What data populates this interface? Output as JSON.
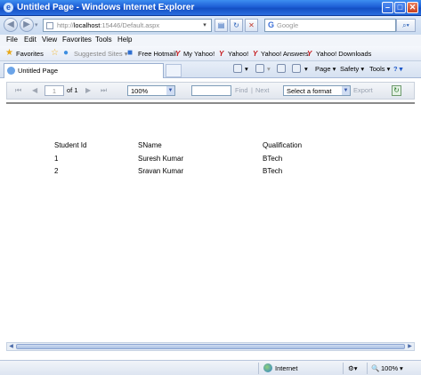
{
  "window": {
    "title": "Untitled Page - Windows Internet Explorer",
    "min": "–",
    "max": "□",
    "close": "✕"
  },
  "address": {
    "back": "◀",
    "forward": "▶",
    "url_prefix": "http://",
    "url_host": "localhost",
    "url_rest": ":15446/Default.aspx",
    "search_placeholder": "Google",
    "search_logo": "G"
  },
  "menu": [
    "File",
    "Edit",
    "View",
    "Favorites",
    "Tools",
    "Help"
  ],
  "favorites_bar": {
    "favorites_label": "Favorites",
    "suggested": "Suggested Sites ▾",
    "items": [
      "Free Hotmail",
      "My Yahoo!",
      "Yahoo!",
      "Yahoo! Answers",
      "Yahoo! Downloads"
    ]
  },
  "tab": {
    "label": "Untitled Page"
  },
  "command_bar": {
    "page": "Page ▾",
    "safety": "Safety ▾",
    "tools": "Tools ▾",
    "help": "? ▾"
  },
  "report_toolbar": {
    "first": "⏮",
    "prev": "◀",
    "page_value": "1",
    "of_label": "of 1",
    "next": "▶",
    "last": "⏭",
    "zoom": "100%",
    "find": "Find",
    "separator": "|",
    "next_link": "Next",
    "format": "Select a format",
    "export": "Export",
    "refresh": "↻"
  },
  "table": {
    "headers": [
      "Student Id",
      "SName",
      "Qualification"
    ],
    "rows": [
      [
        "1",
        "Suresh Kumar",
        "BTech"
      ],
      [
        "2",
        "Sravan Kumar",
        "BTech"
      ]
    ]
  },
  "status": {
    "zone": "Internet",
    "zoom": "100%"
  }
}
